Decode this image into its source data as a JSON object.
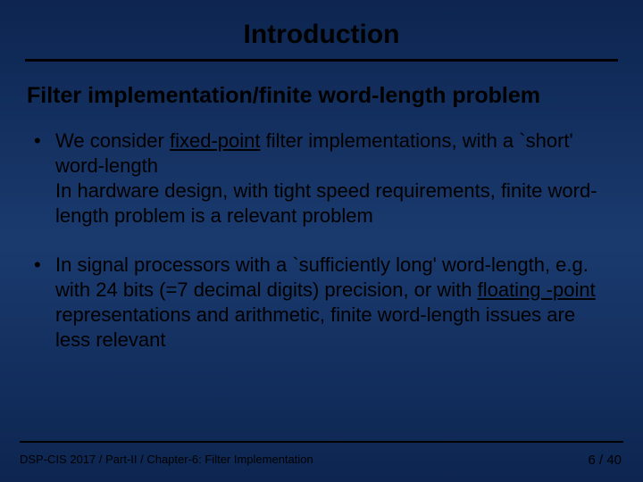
{
  "title": "Introduction",
  "subtitle": "Filter implementation/finite word-length problem",
  "bullets": [
    {
      "pre1": "We consider ",
      "u1": "fixed-point",
      "post1": " filter implementations, with a `short' word-length",
      "line2": "In hardware design, with tight speed requirements, finite word-length problem is a relevant problem"
    },
    {
      "pre1": "In signal processors with a `sufficiently long' word-length, e.g. with 24 bits (=7 decimal digits) precision, or with ",
      "u1": "floating -point ",
      "post1": "representations and arithmetic, finite word-length issues are less relevant",
      "line2": ""
    }
  ],
  "footer": {
    "left": "DSP-CIS 2017 / Part-II / Chapter-6: Filter Implementation",
    "right": "6 / 40"
  }
}
